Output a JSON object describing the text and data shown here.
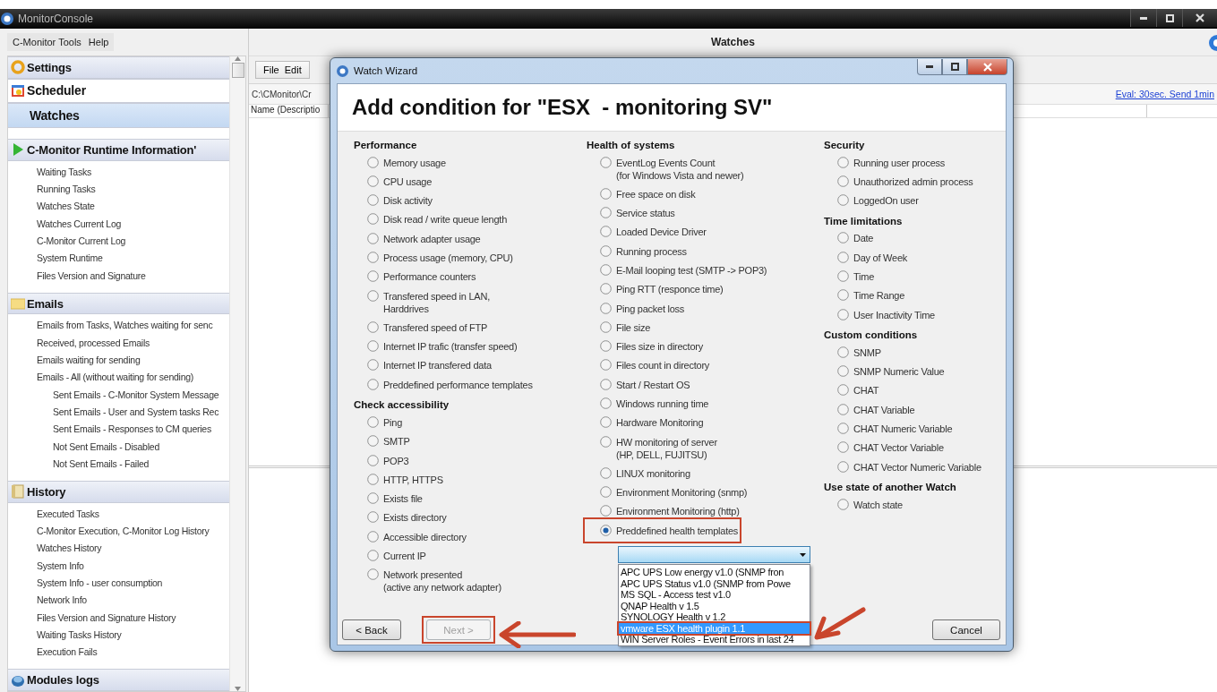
{
  "window": {
    "title": "MonitorConsole"
  },
  "menu": [
    {
      "label": "C-Monitor Tools"
    },
    {
      "label": "Help"
    }
  ],
  "sidebar": {
    "panes": [
      {
        "kind": "settings",
        "title": "Settings",
        "selected": false,
        "hovered": false
      },
      {
        "kind": "scheduler",
        "title": "Scheduler",
        "selected": false,
        "hovered": true
      },
      {
        "kind": "watches",
        "title": "Watches",
        "selected": true,
        "hovered": false
      },
      {
        "kind": "runtime",
        "title": "C-Monitor Runtime Information'",
        "selected": false,
        "hovered": false,
        "items": [
          {
            "label": "Waiting Tasks"
          },
          {
            "label": "Running Tasks"
          },
          {
            "label": "Watches State"
          },
          {
            "label": "Watches Current Log"
          },
          {
            "label": "C-Monitor Current Log"
          },
          {
            "label": "System Runtime"
          },
          {
            "label": "Files Version and Signature"
          }
        ]
      },
      {
        "kind": "emails",
        "title": "Emails",
        "selected": false,
        "hovered": false,
        "items": [
          {
            "label": "Emails from Tasks, Watches waiting for senc"
          },
          {
            "label": "Received, processed Emails"
          },
          {
            "label": "Emails waiting for sending"
          },
          {
            "label": "Emails - All (without waiting for sending)",
            "children": [
              {
                "label": "Sent Emails - C-Monitor System Message"
              },
              {
                "label": "Sent Emails - User and System tasks Rec"
              },
              {
                "label": "Sent Emails - Responses to CM queries"
              },
              {
                "label": "Not Sent Emails - Disabled"
              },
              {
                "label": "Not Sent Emails - Failed"
              }
            ]
          }
        ]
      },
      {
        "kind": "history",
        "title": "History",
        "selected": false,
        "hovered": false,
        "items": [
          {
            "label": "Executed Tasks"
          },
          {
            "label": "C-Monitor Execution, C-Monitor Log History"
          },
          {
            "label": "Watches History"
          },
          {
            "label": "System Info"
          },
          {
            "label": "System Info - user consumption"
          },
          {
            "label": "Network Info"
          },
          {
            "label": "Files Version and Signature History"
          },
          {
            "label": "Waiting Tasks History"
          },
          {
            "label": "Execution Fails"
          }
        ]
      },
      {
        "kind": "modules",
        "title": "Modules logs",
        "selected": false,
        "hovered": false
      }
    ]
  },
  "main": {
    "title": "Watches",
    "toolbar": [
      {
        "label": "File"
      },
      {
        "label": "Edit"
      }
    ],
    "path": "C:\\CMonitor\\Cr",
    "link": "Eval: 30sec. Send 1min",
    "columns": [
      "Name (Descriptio"
    ]
  },
  "dialog": {
    "title": "Watch Wizard",
    "heading": "Add condition for \"ESX  - monitoring SV\"",
    "columns": [
      {
        "groups": [
          {
            "title": "Performance",
            "options": [
              {
                "label": "Memory usage",
                "selected": false
              },
              {
                "label": "CPU usage",
                "selected": false
              },
              {
                "label": "Disk activity",
                "selected": false
              },
              {
                "label": "Disk read / write queue length",
                "selected": false
              },
              {
                "label": "Network adapter usage",
                "selected": false
              },
              {
                "label": "Process usage (memory, CPU)",
                "selected": false
              },
              {
                "label": "Performance counters",
                "selected": false
              },
              {
                "label": "Transfered speed in LAN,\nHarddrives",
                "selected": false
              },
              {
                "label": "Transfered speed of FTP",
                "selected": false
              },
              {
                "label": "Internet IP trafic (transfer speed)",
                "selected": false
              },
              {
                "label": "Internet IP transfered data",
                "selected": false
              },
              {
                "label": "Preddefined performance templates",
                "selected": false
              }
            ]
          },
          {
            "title": "Check accessibility",
            "options": [
              {
                "label": "Ping",
                "selected": false
              },
              {
                "label": "SMTP",
                "selected": false
              },
              {
                "label": "POP3",
                "selected": false
              },
              {
                "label": "HTTP, HTTPS",
                "selected": false
              },
              {
                "label": "Exists file",
                "selected": false
              },
              {
                "label": "Exists directory",
                "selected": false
              },
              {
                "label": "Accessible directory",
                "selected": false
              },
              {
                "label": "Current IP",
                "selected": false
              },
              {
                "label": "Network presented\n(active any network adapter)",
                "selected": false
              }
            ]
          }
        ]
      },
      {
        "groups": [
          {
            "title": "Health of systems",
            "options": [
              {
                "label": "EventLog Events Count\n(for Windows Vista and newer)",
                "selected": false
              },
              {
                "label": "Free space on disk",
                "selected": false
              },
              {
                "label": "Service status",
                "selected": false
              },
              {
                "label": "Loaded Device Driver",
                "selected": false
              },
              {
                "label": "Running process",
                "selected": false
              },
              {
                "label": "E-Mail looping test (SMTP -> POP3)",
                "selected": false
              },
              {
                "label": "Ping RTT (responce time)",
                "selected": false
              },
              {
                "label": "Ping packet loss",
                "selected": false
              },
              {
                "label": "File size",
                "selected": false
              },
              {
                "label": "Files size in directory",
                "selected": false
              },
              {
                "label": "Files count in directory",
                "selected": false
              },
              {
                "label": "Start / Restart OS",
                "selected": false
              },
              {
                "label": "Windows running time",
                "selected": false
              },
              {
                "label": "Hardware Monitoring",
                "selected": false
              },
              {
                "label": "HW monitoring of server\n(HP, DELL, FUJITSU)",
                "selected": false
              },
              {
                "label": "LINUX monitoring",
                "selected": false
              },
              {
                "label": "Environment Monitoring (snmp)",
                "selected": false
              },
              {
                "label": "Environment Monitoring (http)",
                "selected": false
              },
              {
                "label": "Preddefined health templates",
                "selected": true
              }
            ]
          }
        ],
        "dropdown": {
          "options": [
            {
              "label": "APC UPS Low energy v1.0   (SNMP fron",
              "selected": false
            },
            {
              "label": "APC UPS Status v1.0   (SNMP from Powe",
              "selected": false
            },
            {
              "label": "MS SQL - Access test v1.0",
              "selected": false
            },
            {
              "label": "QNAP Health v 1.5",
              "selected": false
            },
            {
              "label": "SYNOLOGY Health v 1.2",
              "selected": false
            },
            {
              "label": "vmware ESX health plugin 1.1",
              "selected": true
            },
            {
              "label": "WIN Server Roles - Event Errors in last 24",
              "selected": false
            }
          ]
        }
      },
      {
        "groups": [
          {
            "title": "Security",
            "options": [
              {
                "label": "Running user process",
                "selected": false
              },
              {
                "label": "Unauthorized admin process",
                "selected": false
              },
              {
                "label": "LoggedOn user",
                "selected": false
              }
            ]
          },
          {
            "title": "Time limitations",
            "options": [
              {
                "label": "Date",
                "selected": false
              },
              {
                "label": "Day of Week",
                "selected": false
              },
              {
                "label": "Time",
                "selected": false
              },
              {
                "label": "Time Range",
                "selected": false
              },
              {
                "label": "User Inactivity Time",
                "selected": false
              }
            ]
          },
          {
            "title": "Custom conditions",
            "options": [
              {
                "label": "SNMP",
                "selected": false
              },
              {
                "label": "SNMP Numeric Value",
                "selected": false
              },
              {
                "label": "CHAT",
                "selected": false
              },
              {
                "label": "CHAT Variable",
                "selected": false
              },
              {
                "label": "CHAT Numeric Variable",
                "selected": false
              },
              {
                "label": "CHAT Vector Variable",
                "selected": false
              },
              {
                "label": "CHAT Vector Numeric Variable",
                "selected": false
              }
            ]
          },
          {
            "title": "Use state of another Watch",
            "options": [
              {
                "label": "Watch state",
                "selected": false
              }
            ]
          }
        ]
      }
    ],
    "buttons": [
      {
        "label": "< Back",
        "disabled": false,
        "highlighted": false
      },
      {
        "label": "Next >",
        "disabled": true,
        "highlighted": true
      },
      {
        "label": "Cancel",
        "disabled": false,
        "highlighted": false
      }
    ]
  }
}
